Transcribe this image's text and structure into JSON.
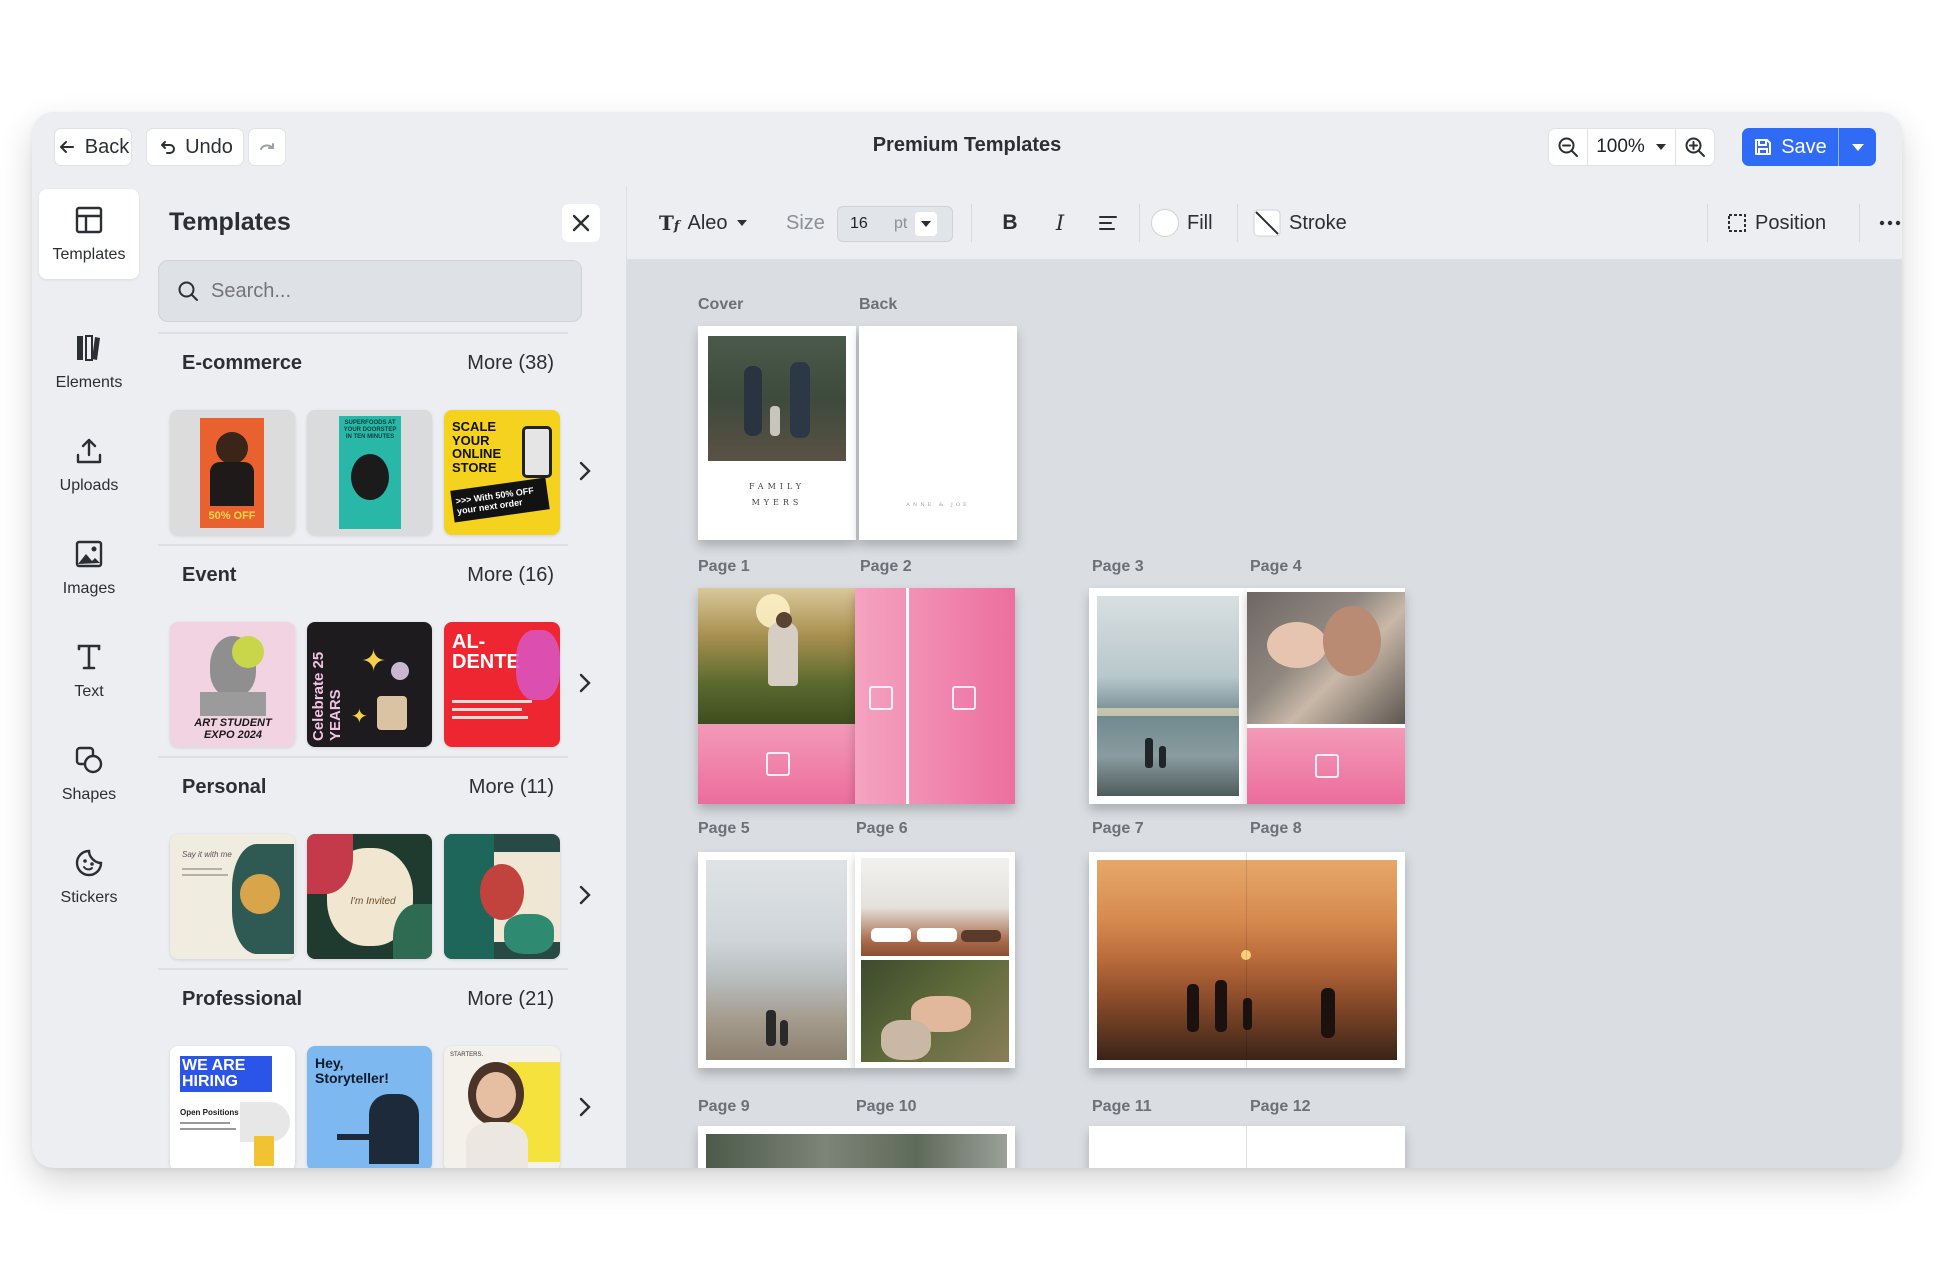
{
  "topbar": {
    "back_label": "Back",
    "undo_label": "Undo",
    "title": "Premium Templates",
    "zoom": "100%",
    "save_label": "Save"
  },
  "rail": {
    "items": [
      {
        "label": "Templates",
        "icon": "templates-icon"
      },
      {
        "label": "Elements",
        "icon": "elements-icon"
      },
      {
        "label": "Uploads",
        "icon": "upload-icon"
      },
      {
        "label": "Images",
        "icon": "image-icon"
      },
      {
        "label": "Text",
        "icon": "text-icon"
      },
      {
        "label": "Shapes",
        "icon": "shapes-icon"
      },
      {
        "label": "Stickers",
        "icon": "sticker-icon"
      }
    ]
  },
  "panel": {
    "title": "Templates",
    "search_placeholder": "Search...",
    "categories": [
      {
        "name": "E-commerce",
        "more": "More (38)",
        "thumbs": [
          {
            "text": "50% OFF"
          },
          {
            "text": "SUPERFOODS AT YOUR DOORSTEP IN TEN MINUTES"
          },
          {
            "text": "SCALE YOUR ONLINE STORE",
            "sub": ">>> With 50% OFF your next order"
          }
        ]
      },
      {
        "name": "Event",
        "more": "More (16)",
        "thumbs": [
          {
            "text": "ART STUDENT EXPO 2024"
          },
          {
            "text": "Celebrate 25 YEARS"
          },
          {
            "text": "AL-DENTE"
          }
        ]
      },
      {
        "name": "Personal",
        "more": "More (11)",
        "thumbs": [
          {
            "text": "Say it with me"
          },
          {
            "text": "I'm Invited"
          },
          {
            "text": ""
          }
        ]
      },
      {
        "name": "Professional",
        "more": "More (21)",
        "thumbs": [
          {
            "text": "WE ARE HIRING",
            "sub": "Open Positions"
          },
          {
            "text": "Hey, Storyteller!"
          },
          {
            "text": "STARTERS."
          }
        ]
      }
    ]
  },
  "toolbar": {
    "font": "Aleo",
    "size_label": "Size",
    "size_value": "16",
    "size_unit": "pt",
    "fill_label": "Fill",
    "stroke_label": "Stroke",
    "position_label": "Position"
  },
  "canvas": {
    "labels": {
      "cover": "Cover",
      "back": "Back",
      "p1": "Page 1",
      "p2": "Page 2",
      "p3": "Page 3",
      "p4": "Page 4",
      "p5": "Page 5",
      "p6": "Page 6",
      "p7": "Page 7",
      "p8": "Page 8",
      "p9": "Page 9",
      "p10": "Page 10",
      "p11": "Page 11",
      "p12": "Page 12"
    },
    "cover_text_1": "FAMILY",
    "cover_text_2": "MYERS",
    "back_text": "ANNE & JOE"
  },
  "colors": {
    "accent": "#2f6bf5",
    "placeholder_pink": "#f07aa8"
  }
}
